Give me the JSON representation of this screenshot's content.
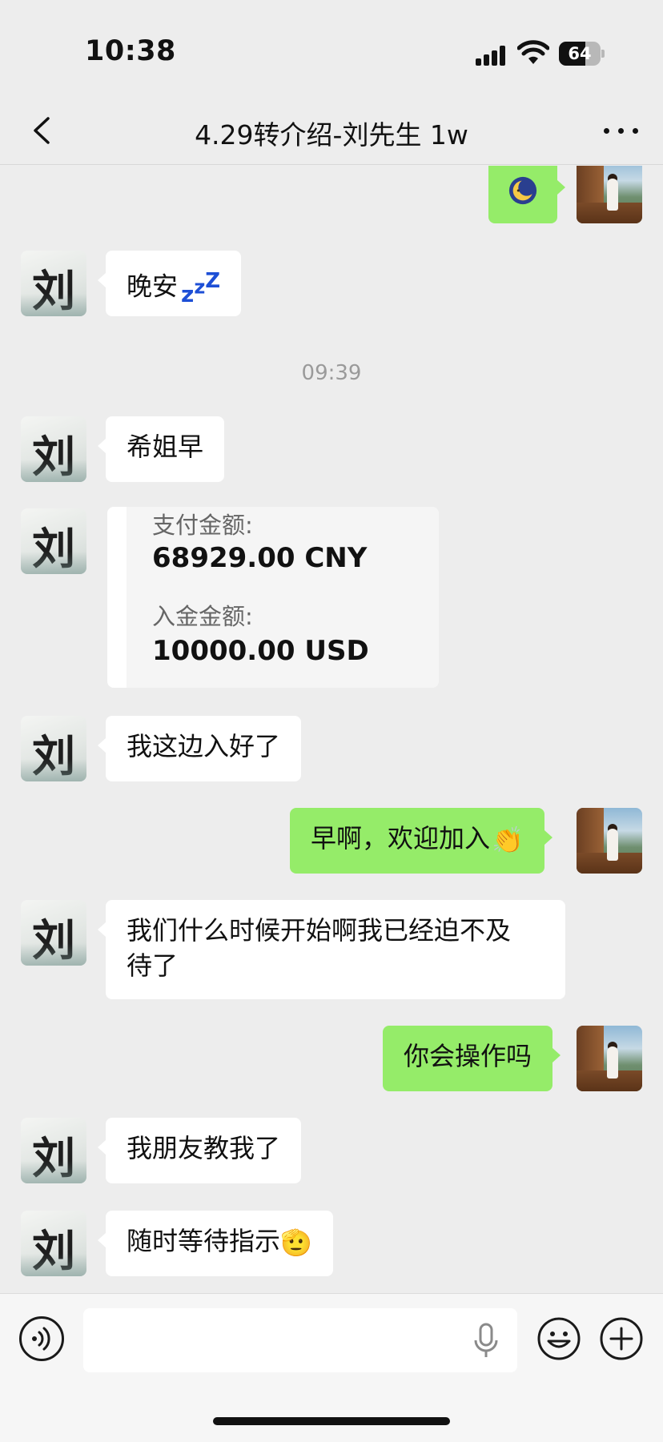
{
  "status_bar": {
    "time": "10:38",
    "battery": "64",
    "battery_level": 0.64
  },
  "nav": {
    "title": "4.29转介绍-刘先生 1w",
    "back_icon": "chevron-left-icon",
    "more_icon": "more-horizontal-icon"
  },
  "contact": {
    "avatar_char": "刘"
  },
  "messages": [
    {
      "side": "right",
      "type": "emoji",
      "content": "moon-face-emoji"
    },
    {
      "side": "left",
      "text": "晚安",
      "emoji": "💤"
    },
    {
      "type": "timestamp",
      "text": "09:39"
    },
    {
      "side": "left",
      "text": "希姐早"
    },
    {
      "side": "left",
      "type": "payment",
      "pay_label": "支付金额:",
      "pay_value": "68929.00 CNY",
      "deposit_label": "入金金额:",
      "deposit_value": "10000.00 USD"
    },
    {
      "side": "left",
      "text": "我这边入好了"
    },
    {
      "side": "right",
      "text": "早啊，欢迎加入",
      "emoji": "👏"
    },
    {
      "side": "left",
      "text_line1": "我们什么时候开始啊我已经迫不及",
      "text_line2": "待了"
    },
    {
      "side": "right",
      "text": "你会操作吗"
    },
    {
      "side": "left",
      "text": "我朋友教我了"
    },
    {
      "side": "left",
      "text": "随时等待指示",
      "emoji": "🫡"
    }
  ],
  "input_bar": {
    "placeholder": "",
    "voice_icon": "voice-icon",
    "mic_icon": "microphone-icon",
    "emoji_icon": "smiley-icon",
    "plus_icon": "plus-icon"
  }
}
